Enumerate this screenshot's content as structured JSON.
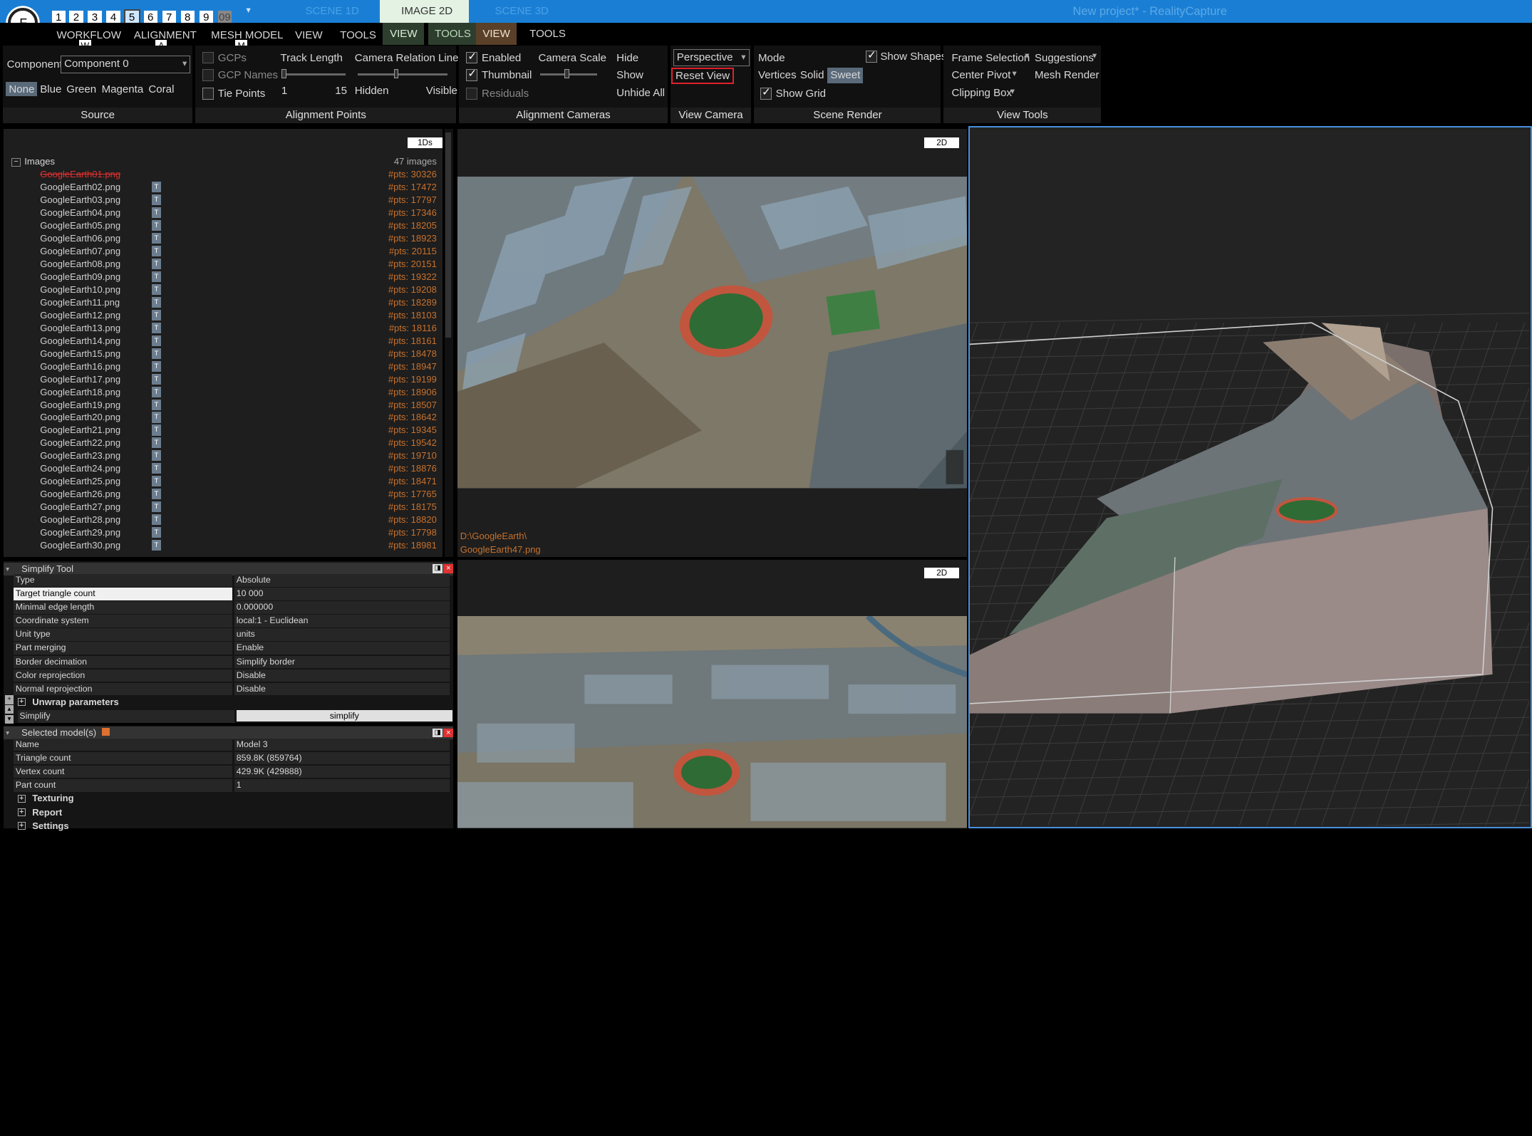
{
  "titlebar": {
    "numbers": [
      "1",
      "2",
      "3",
      "4",
      "5",
      "6",
      "7",
      "8",
      "9",
      "09"
    ],
    "tabs": [
      "SCENE 1D",
      "IMAGE 2D",
      "SCENE 3D"
    ],
    "project_title": "New project* - RealityCapture",
    "accent": "#1a7fd4"
  },
  "menu": {
    "items": [
      "WORKFLOW",
      "ALIGNMENT",
      "MESH MODEL",
      "VIEW",
      "TOOLS",
      "VIEW",
      "TOOLS",
      "VIEW",
      "TOOLS"
    ],
    "keys": [
      "W",
      "A",
      "M"
    ]
  },
  "ribbon": {
    "source": {
      "component_label": "Component",
      "component_value": "Component 0",
      "colors": [
        "None",
        "Blue",
        "Green",
        "Magenta",
        "Coral"
      ],
      "footer": "Source"
    },
    "alignment_points": {
      "gcps": "GCPs",
      "gcp_names": "GCP Names",
      "tie_points": "Tie Points",
      "track_length": "Track Length",
      "track_min": "1",
      "track_max": "15",
      "camera_relation_lines": "Camera Relation Lines",
      "hidden": "Hidden",
      "visible": "Visible",
      "footer": "Alignment Points"
    },
    "alignment_cameras": {
      "enabled": "Enabled",
      "thumbnail": "Thumbnail",
      "residuals": "Residuals",
      "camera_scale": "Camera Scale",
      "hide": "Hide",
      "show": "Show",
      "unhide_all": "Unhide All",
      "footer": "Alignment Cameras"
    },
    "view_camera": {
      "projection": "Perspective",
      "reset_view": "Reset View",
      "footer": "View Camera"
    },
    "scene_render": {
      "mode": "Mode",
      "vertices": "Vertices",
      "solid": "Solid",
      "sweet": "Sweet",
      "show_shapes": "Show Shapes",
      "show_grid": "Show Grid",
      "footer": "Scene Render"
    },
    "view_tools": {
      "frame_selection": "Frame Selection",
      "suggestions": "Suggestions",
      "center_pivot": "Center Pivot",
      "mesh_render": "Mesh Render",
      "clipping_box": "Clipping Box",
      "footer": "View Tools"
    }
  },
  "images_panel": {
    "badge": "1Ds",
    "root": "Images",
    "count": "47 images",
    "items": [
      {
        "name": "GoogleEarth01.png",
        "pts": "#pts: 30326"
      },
      {
        "name": "GoogleEarth02.png",
        "pts": "#pts: 17472"
      },
      {
        "name": "GoogleEarth03.png",
        "pts": "#pts: 17797"
      },
      {
        "name": "GoogleEarth04.png",
        "pts": "#pts: 17346"
      },
      {
        "name": "GoogleEarth05.png",
        "pts": "#pts: 18205"
      },
      {
        "name": "GoogleEarth06.png",
        "pts": "#pts: 18923"
      },
      {
        "name": "GoogleEarth07.png",
        "pts": "#pts: 20115"
      },
      {
        "name": "GoogleEarth08.png",
        "pts": "#pts: 20151"
      },
      {
        "name": "GoogleEarth09.png",
        "pts": "#pts: 19322"
      },
      {
        "name": "GoogleEarth10.png",
        "pts": "#pts: 19208"
      },
      {
        "name": "GoogleEarth11.png",
        "pts": "#pts: 18289"
      },
      {
        "name": "GoogleEarth12.png",
        "pts": "#pts: 18103"
      },
      {
        "name": "GoogleEarth13.png",
        "pts": "#pts: 18116"
      },
      {
        "name": "GoogleEarth14.png",
        "pts": "#pts: 18161"
      },
      {
        "name": "GoogleEarth15.png",
        "pts": "#pts: 18478"
      },
      {
        "name": "GoogleEarth16.png",
        "pts": "#pts: 18947"
      },
      {
        "name": "GoogleEarth17.png",
        "pts": "#pts: 19199"
      },
      {
        "name": "GoogleEarth18.png",
        "pts": "#pts: 18906"
      },
      {
        "name": "GoogleEarth19.png",
        "pts": "#pts: 18507"
      },
      {
        "name": "GoogleEarth20.png",
        "pts": "#pts: 18642"
      },
      {
        "name": "GoogleEarth21.png",
        "pts": "#pts: 19345"
      },
      {
        "name": "GoogleEarth22.png",
        "pts": "#pts: 19542"
      },
      {
        "name": "GoogleEarth23.png",
        "pts": "#pts: 19710"
      },
      {
        "name": "GoogleEarth24.png",
        "pts": "#pts: 18876"
      },
      {
        "name": "GoogleEarth25.png",
        "pts": "#pts: 18471"
      },
      {
        "name": "GoogleEarth26.png",
        "pts": "#pts: 17765"
      },
      {
        "name": "GoogleEarth27.png",
        "pts": "#pts: 18175"
      },
      {
        "name": "GoogleEarth28.png",
        "pts": "#pts: 18820"
      },
      {
        "name": "GoogleEarth29.png",
        "pts": "#pts: 17798"
      },
      {
        "name": "GoogleEarth30.png",
        "pts": "#pts: 18981"
      }
    ]
  },
  "simplify_tool": {
    "title": "Simplify Tool",
    "rows": [
      {
        "k": "Type",
        "v": "Absolute"
      },
      {
        "k": "Target triangle count",
        "v": "10 000"
      },
      {
        "k": "Minimal edge length",
        "v": "0.000000"
      },
      {
        "k": "Coordinate system",
        "v": "local:1 - Euclidean"
      },
      {
        "k": "Unit type",
        "v": "units"
      },
      {
        "k": "Part merging",
        "v": "Enable"
      },
      {
        "k": "Border decimation",
        "v": "Simplify border"
      },
      {
        "k": "Color reprojection",
        "v": "Disable"
      },
      {
        "k": "Normal reprojection",
        "v": "Disable"
      }
    ],
    "unwrap": "Unwrap parameters",
    "simplify_label": "Simplify",
    "simplify_button": "simplify"
  },
  "selected_model": {
    "title": "Selected model(s)",
    "rows": [
      {
        "k": "Name",
        "v": "Model 3"
      },
      {
        "k": "Triangle count",
        "v": "859.8K (859764)"
      },
      {
        "k": "Vertex count",
        "v": "429.9K (429888)"
      },
      {
        "k": "Part count",
        "v": "1"
      }
    ],
    "sections": [
      "Texturing",
      "Report",
      "Settings"
    ]
  },
  "image_view_top": {
    "badge": "2D",
    "path": "D:\\GoogleEarth\\",
    "file": "GoogleEarth47.png"
  },
  "image_view_bottom": {
    "badge": "2D"
  }
}
